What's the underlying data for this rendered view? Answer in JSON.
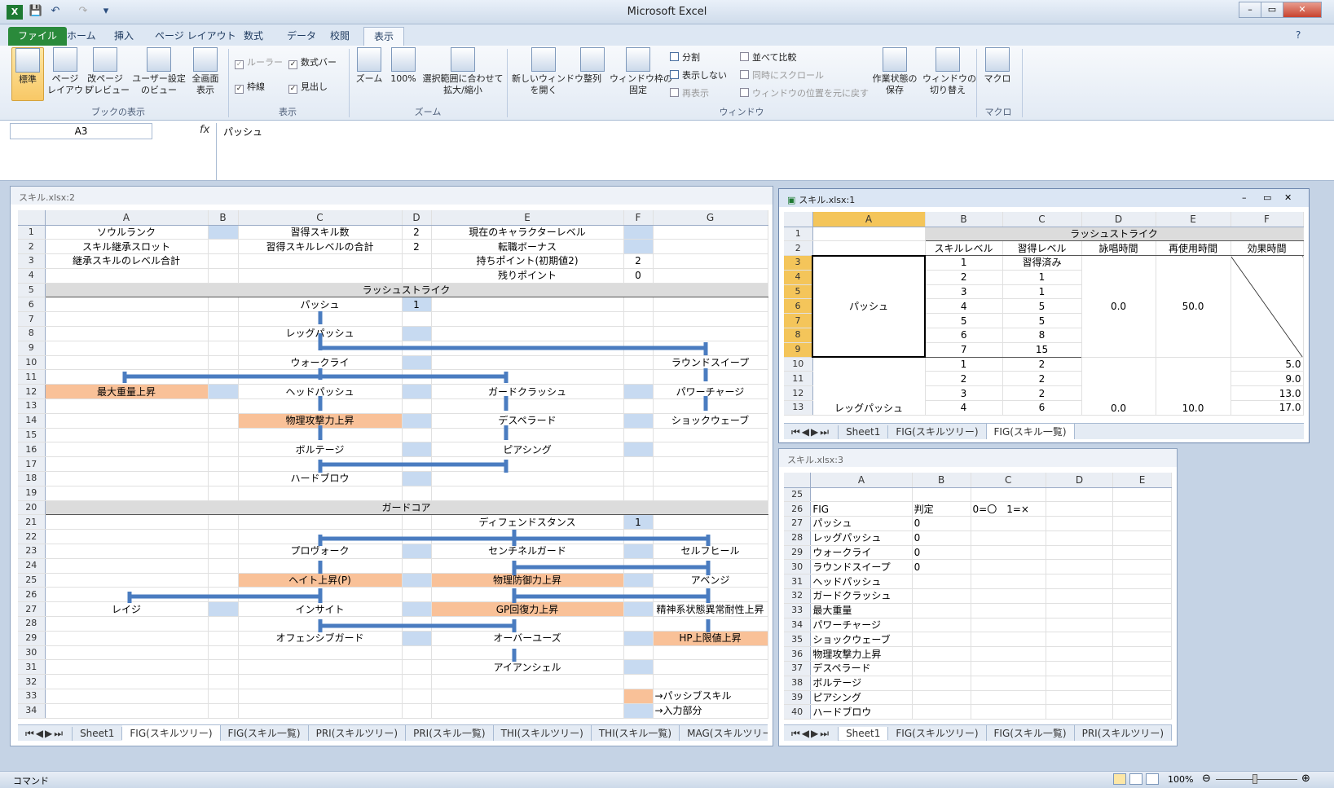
{
  "app": {
    "title": "Microsoft Excel"
  },
  "tabs": [
    "ファイル",
    "ホーム",
    "挿入",
    "ページ レイアウト",
    "数式",
    "データ",
    "校閲",
    "表示"
  ],
  "active_tab": "表示",
  "ribbon": {
    "book_view": {
      "normal": "標準",
      "page_layout": "ページ\nレイアウト",
      "page_break": "改ページ\nプレビュー",
      "custom": "ユーザー設定\nのビュー",
      "full": "全画面\n表示",
      "group": "ブックの表示"
    },
    "show": {
      "ruler": "ルーラー",
      "formula_bar": "数式バー",
      "gridlines": "枠線",
      "headings": "見出し",
      "group": "表示"
    },
    "zoom": {
      "zoom": "ズーム",
      "hundred": "100%",
      "selection": "選択範囲に合わせて\n拡大/縮小",
      "group": "ズーム"
    },
    "window": {
      "new": "新しいウィンドウ\nを開く",
      "arrange": "整列",
      "freeze": "ウィンドウ枠の\n固定",
      "split": "分割",
      "hide": "表示しない",
      "unhide": "再表示",
      "side": "並べて比較",
      "sync": "同時にスクロール",
      "reset": "ウィンドウの位置を元に戻す",
      "save": "作業状態の\n保存",
      "switch": "ウィンドウの\n切り替え",
      "group": "ウィンドウ"
    },
    "macros": {
      "label": "マクロ",
      "group": "マクロ"
    }
  },
  "formula": {
    "cell": "A3",
    "fx": "fx",
    "content": "パッシュ"
  },
  "win2": {
    "title": "スキル.xlsx:2",
    "cols": [
      "A",
      "B",
      "C",
      "D",
      "E",
      "F",
      "G"
    ],
    "rows": [
      "1",
      "2",
      "3",
      "4",
      "5",
      "6",
      "7",
      "8",
      "9",
      "10",
      "11",
      "12",
      "13",
      "14",
      "15",
      "16",
      "17",
      "18",
      "19",
      "20",
      "21",
      "22",
      "23",
      "24",
      "25",
      "26",
      "27",
      "28",
      "29",
      "30",
      "31",
      "32",
      "33",
      "34"
    ],
    "r1": {
      "a": "ソウルランク",
      "c": "習得スキル数",
      "d": "2",
      "e": "現在のキャラクターレベル"
    },
    "r2": {
      "a": "スキル継承スロット",
      "c": "習得スキルレベルの合計",
      "d": "2",
      "e": "転職ボーナス"
    },
    "r3": {
      "a": "継承スキルのレベル合計",
      "e": "持ちポイント(初期値2)",
      "f": "2"
    },
    "r4": {
      "e": "残りポイント",
      "f": "0"
    },
    "r5": "ラッシュストライク",
    "r6": {
      "c": "パッシュ",
      "d": "1"
    },
    "r8": {
      "c": "レッグパッシュ"
    },
    "r10": {
      "c": "ウォークライ",
      "g": "ラウンドスイープ"
    },
    "r12": {
      "a": "最大重量上昇",
      "c": "ヘッドパッシュ",
      "e": "ガードクラッシュ",
      "g": "パワーチャージ"
    },
    "r14": {
      "c": "物理攻撃力上昇",
      "e": "デスペラード",
      "g": "ショックウェーブ"
    },
    "r16": {
      "c": "ボルテージ",
      "e": "ピアシング"
    },
    "r18": {
      "c": "ハードブロウ"
    },
    "r20": "ガードコア",
    "r21": {
      "e": "ディフェンドスタンス",
      "f": "1"
    },
    "r23": {
      "c": "プロヴォーク",
      "e": "センチネルガード",
      "g": "セルフヒール"
    },
    "r25": {
      "c": "ヘイト上昇(P)",
      "e": "物理防御力上昇",
      "g": "アベンジ"
    },
    "r27": {
      "a": "レイジ",
      "c": "インサイト",
      "e": "GP回復力上昇",
      "g": "精神系状態異常耐性上昇"
    },
    "r29": {
      "c": "オフェンシブガード",
      "e": "オーバーユーズ",
      "g": "HP上限値上昇"
    },
    "r31": {
      "e": "アイアンシェル"
    },
    "r33": {
      "g": "→パッシブスキル"
    },
    "r34": {
      "g": "→入力部分"
    },
    "sheets": [
      "Sheet1",
      "FIG(スキルツリー)",
      "FIG(スキル一覧)",
      "PRI(スキルツリー)",
      "PRI(スキル一覧)",
      "THI(スキルツリー)",
      "THI(スキル一覧)",
      "MAG(スキルツリー)"
    ],
    "active_sheet": "FIG(スキルツリー)"
  },
  "win1": {
    "title": "スキル.xlsx:1",
    "cols": [
      "A",
      "B",
      "C",
      "D",
      "E",
      "F"
    ],
    "rows": [
      "1",
      "2",
      "3",
      "4",
      "5",
      "6",
      "7",
      "8",
      "9",
      "10",
      "11",
      "12",
      "13"
    ],
    "header": "ラッシュストライク",
    "subheaders": [
      "スキルレベル",
      "習得レベル",
      "詠唱時間",
      "再使用時間",
      "効果時間"
    ],
    "pash": {
      "name": "パッシュ",
      "levels": [
        "1",
        "2",
        "3",
        "4",
        "5",
        "6",
        "7"
      ],
      "learn": [
        "習得済み",
        "1",
        "1",
        "5",
        "5",
        "8",
        "15"
      ],
      "cast": "0.0",
      "reuse": "50.0"
    },
    "leg": {
      "name": "レッグパッシュ",
      "levels": [
        "1",
        "2",
        "3",
        "4"
      ],
      "learn": [
        "2",
        "2",
        "2",
        "6"
      ],
      "cast": "0.0",
      "reuse": "10.0",
      "effect": [
        "5.0",
        "9.0",
        "13.0",
        "17.0"
      ]
    },
    "sheets": [
      "Sheet1",
      "FIG(スキルツリー)",
      "FIG(スキル一覧)"
    ],
    "active_sheet": "FIG(スキル一覧)"
  },
  "win3": {
    "title": "スキル.xlsx:3",
    "cols": [
      "A",
      "B",
      "C",
      "D",
      "E"
    ],
    "rows": [
      "25",
      "26",
      "27",
      "28",
      "29",
      "30",
      "31",
      "32",
      "33",
      "34",
      "35",
      "36",
      "37",
      "38",
      "39",
      "40"
    ],
    "names": [
      "",
      "FIG",
      "パッシュ",
      "レッグパッシュ",
      "ウォークライ",
      "ラウンドスイープ",
      "ヘッドパッシュ",
      "ガードクラッシュ",
      "最大重量",
      "パワーチャージ",
      "ショックウェーブ",
      "物理攻撃力上昇",
      "デスペラード",
      "ボルテージ",
      "ピアシング",
      "ハードブロウ"
    ],
    "b": [
      "",
      "判定",
      "0",
      "0",
      "0",
      "0",
      "",
      "",
      "",
      "",
      "",
      "",
      "",
      "",
      "",
      ""
    ],
    "c": [
      "",
      "0=〇　1=×",
      "",
      "",
      "",
      "",
      "",
      "",
      "",
      "",
      "",
      "",
      "",
      "",
      "",
      ""
    ],
    "sheets": [
      "Sheet1",
      "FIG(スキルツリー)",
      "FIG(スキル一覧)",
      "PRI(スキルツリー)"
    ],
    "active_sheet": "Sheet1"
  },
  "status": {
    "mode": "コマンド",
    "zoom": "100%"
  }
}
